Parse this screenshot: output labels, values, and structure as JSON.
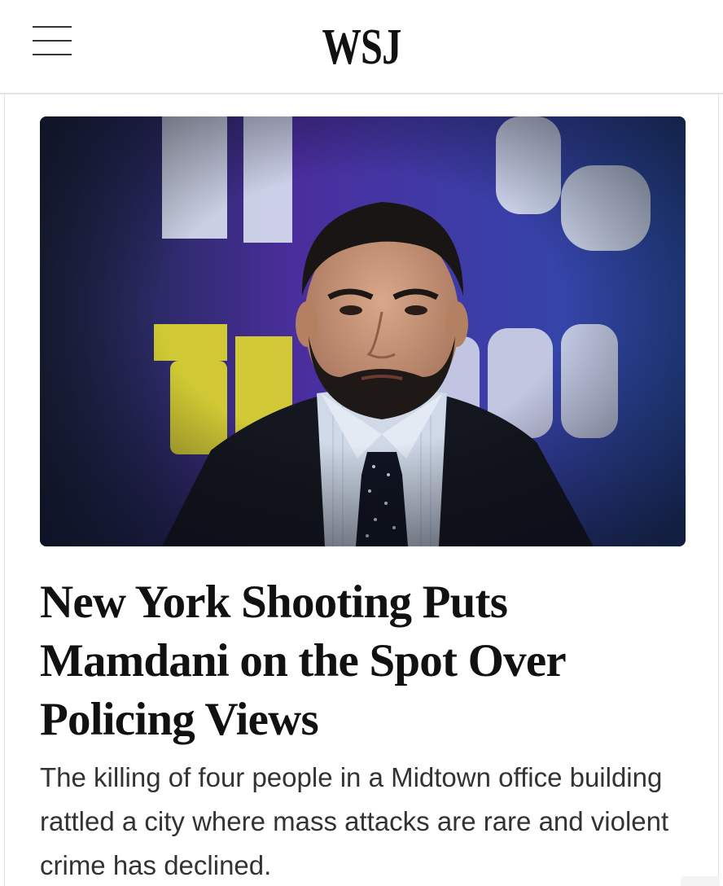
{
  "header": {
    "logo": "WSJ",
    "menu_icon": "hamburger-menu-icon"
  },
  "article": {
    "hero_image": {
      "subject": "man with beard in suit and polka-dot tie",
      "background_letters": [
        "BIS",
        "ering"
      ],
      "colors": {
        "background_purple": "#4a2e9e",
        "background_blue": "#2a4ea8",
        "letters_white": "#dfe6f3",
        "letters_yellow": "#d9d232",
        "suit": "#14171f",
        "shirt": "#cfd9e8"
      }
    },
    "headline": "New York Shooting Puts Mamdani on the Spot Over Policing Views",
    "dek": "The killing of four people in a Midtown office building rattled a city where mass attacks are rare and violent crime has declined."
  }
}
